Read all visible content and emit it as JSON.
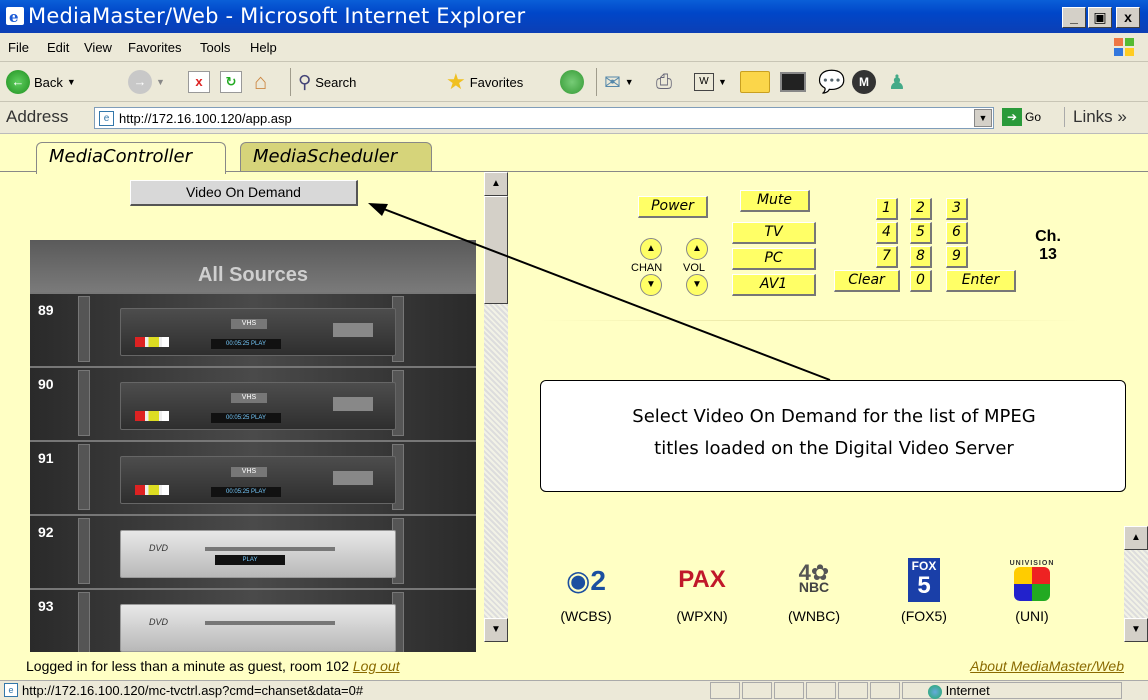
{
  "window": {
    "title": "MediaMaster/Web - Microsoft Internet Explorer",
    "controls": [
      "_",
      "ș",
      "x"
    ]
  },
  "menu": [
    "File",
    "Edit",
    "View",
    "Favorites",
    "Tools",
    "Help"
  ],
  "toolbar": {
    "back": "Back",
    "search": "Search",
    "favorites": "Favorites"
  },
  "address": {
    "label": "Address",
    "url": "http://172.16.100.120/app.asp",
    "go": "Go",
    "links": "Links"
  },
  "tabs": [
    {
      "label": "MediaController",
      "active": true
    },
    {
      "label": "MediaScheduler",
      "active": false
    }
  ],
  "vod_button": "Video On Demand",
  "rack": {
    "title": "All Sources",
    "slots": [
      {
        "num": "89",
        "type": "VHS"
      },
      {
        "num": "90",
        "type": "VHS"
      },
      {
        "num": "91",
        "type": "VHS"
      },
      {
        "num": "92",
        "type": "DVD"
      },
      {
        "num": "93",
        "type": "DVD"
      }
    ]
  },
  "remote": {
    "power": "Power",
    "mute": "Mute",
    "tv": "TV",
    "pc": "PC",
    "av1": "AV1",
    "chan": "CHAN",
    "vol": "VOL",
    "digits": [
      "1",
      "2",
      "3",
      "4",
      "5",
      "6",
      "7",
      "8",
      "9"
    ],
    "clear": "Clear",
    "zero": "0",
    "enter": "Enter",
    "ch_label": "Ch.",
    "ch_value": "13"
  },
  "callout": {
    "line1": "Select Video On Demand for the list of MPEG",
    "line2": "titles loaded on the Digital Video Server"
  },
  "channels": [
    {
      "logo": "CBS2",
      "label": "(WCBS)",
      "color": "#1b4fa0"
    },
    {
      "logo": "PAX",
      "label": "(WPXN)",
      "color": "#c0182a"
    },
    {
      "logo": "NBC",
      "label": "(WNBC)",
      "color": "#444444"
    },
    {
      "logo": "FOX 5",
      "label": "(FOX5)",
      "color": "#1a3fa8"
    },
    {
      "logo": "UNIVISION",
      "label": "(UNI)",
      "color": "#2a2a8a"
    }
  ],
  "footer": {
    "logged": "Logged in for less than a minute as guest, room 102",
    "logout": "Log out",
    "about": "About MediaMaster/Web"
  },
  "status": {
    "url": "http://172.16.100.120/mc-tvctrl.asp?cmd=chanset&data=0#",
    "zone": "Internet"
  }
}
